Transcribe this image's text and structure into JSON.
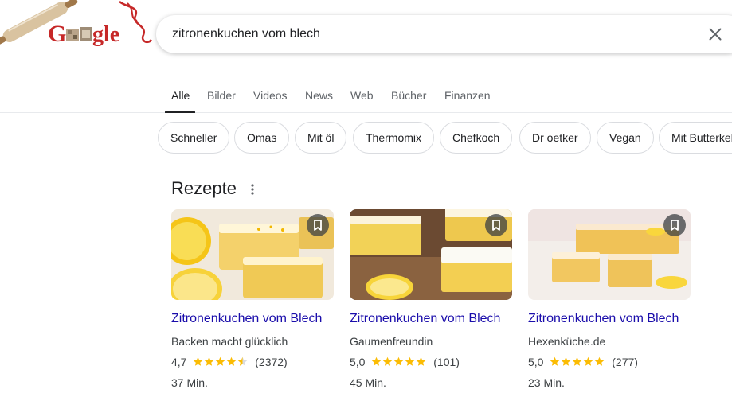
{
  "search": {
    "query": "zitronenkuchen vom blech"
  },
  "logo": {
    "text": "Google"
  },
  "tabs": [
    {
      "label": "Alle",
      "active": true
    },
    {
      "label": "Bilder",
      "active": false
    },
    {
      "label": "Videos",
      "active": false
    },
    {
      "label": "News",
      "active": false
    },
    {
      "label": "Web",
      "active": false
    },
    {
      "label": "Bücher",
      "active": false
    },
    {
      "label": "Finanzen",
      "active": false
    }
  ],
  "chips": [
    {
      "label": "Schneller"
    },
    {
      "label": "Omas"
    },
    {
      "label": "Mit öl"
    },
    {
      "label": "Thermomix"
    },
    {
      "label": "Chefkoch"
    },
    {
      "label": "Dr oetker"
    },
    {
      "label": "Vegan"
    },
    {
      "label": "Mit Butterkeks"
    }
  ],
  "recipes": {
    "title": "Rezepte",
    "cards": [
      {
        "title": "Zitronenkuchen vom Blech",
        "source": "Backen macht glücklich",
        "rating": "4,7",
        "stars": 4.5,
        "reviews": "(2372)",
        "time": "37 Min."
      },
      {
        "title": "Zitronenkuchen vom Blech",
        "source": "Gaumenfreundin",
        "rating": "5,0",
        "stars": 5,
        "reviews": "(101)",
        "time": "45 Min."
      },
      {
        "title": "Zitronenkuchen vom Blech",
        "source": "Hexenküche.de",
        "rating": "5,0",
        "stars": 5,
        "reviews": "(277)",
        "time": "23 Min."
      }
    ]
  },
  "colors": {
    "link": "#1a0dab",
    "star": "#fbbc04",
    "star_empty": "#dadce0"
  },
  "icons": {
    "clear": "close-icon",
    "more": "more-vert-icon",
    "bookmark": "bookmark-icon"
  }
}
